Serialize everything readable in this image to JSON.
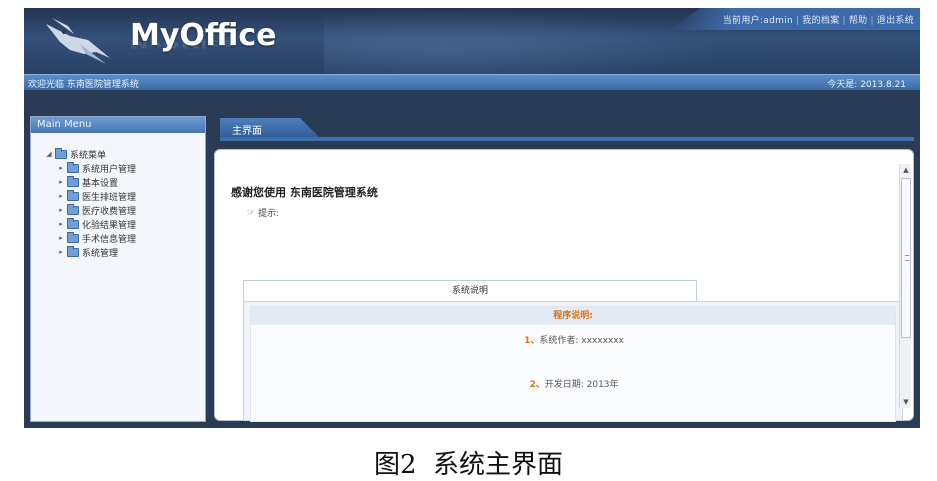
{
  "header": {
    "logo_text": "MyOffice",
    "top_links": [
      "当前用户:admin",
      "我的档案",
      "帮助",
      "退出系统"
    ]
  },
  "infobar": {
    "welcome": "欢迎光临 东南医院管理系统",
    "date": "今天是: 2013.8.21"
  },
  "sidebar": {
    "title": "Main Menu",
    "root": "系统菜单",
    "items": [
      {
        "label": "系统用户管理"
      },
      {
        "label": "基本设置"
      },
      {
        "label": "医生排班管理"
      },
      {
        "label": "医疗收费管理"
      },
      {
        "label": "化验结果管理"
      },
      {
        "label": "手术信息管理"
      },
      {
        "label": "系统管理"
      }
    ]
  },
  "main": {
    "tab_label": "主界面",
    "welcome_title": "感谢您使用 东南医院管理系统",
    "tip_label": "提示:",
    "sys_tab_label": "系统说明",
    "sys_head": "程序说明:",
    "lines": [
      {
        "num": "1、",
        "text": "系统作者: xxxxxxxx"
      },
      {
        "num": "2、",
        "text": "开发日期: 2013年"
      }
    ]
  },
  "caption": {
    "fig": "图2",
    "text": "系统主界面"
  },
  "colors": {
    "header_bg": "#2a4166",
    "accent": "#3f6fab",
    "highlight": "#e07010"
  }
}
